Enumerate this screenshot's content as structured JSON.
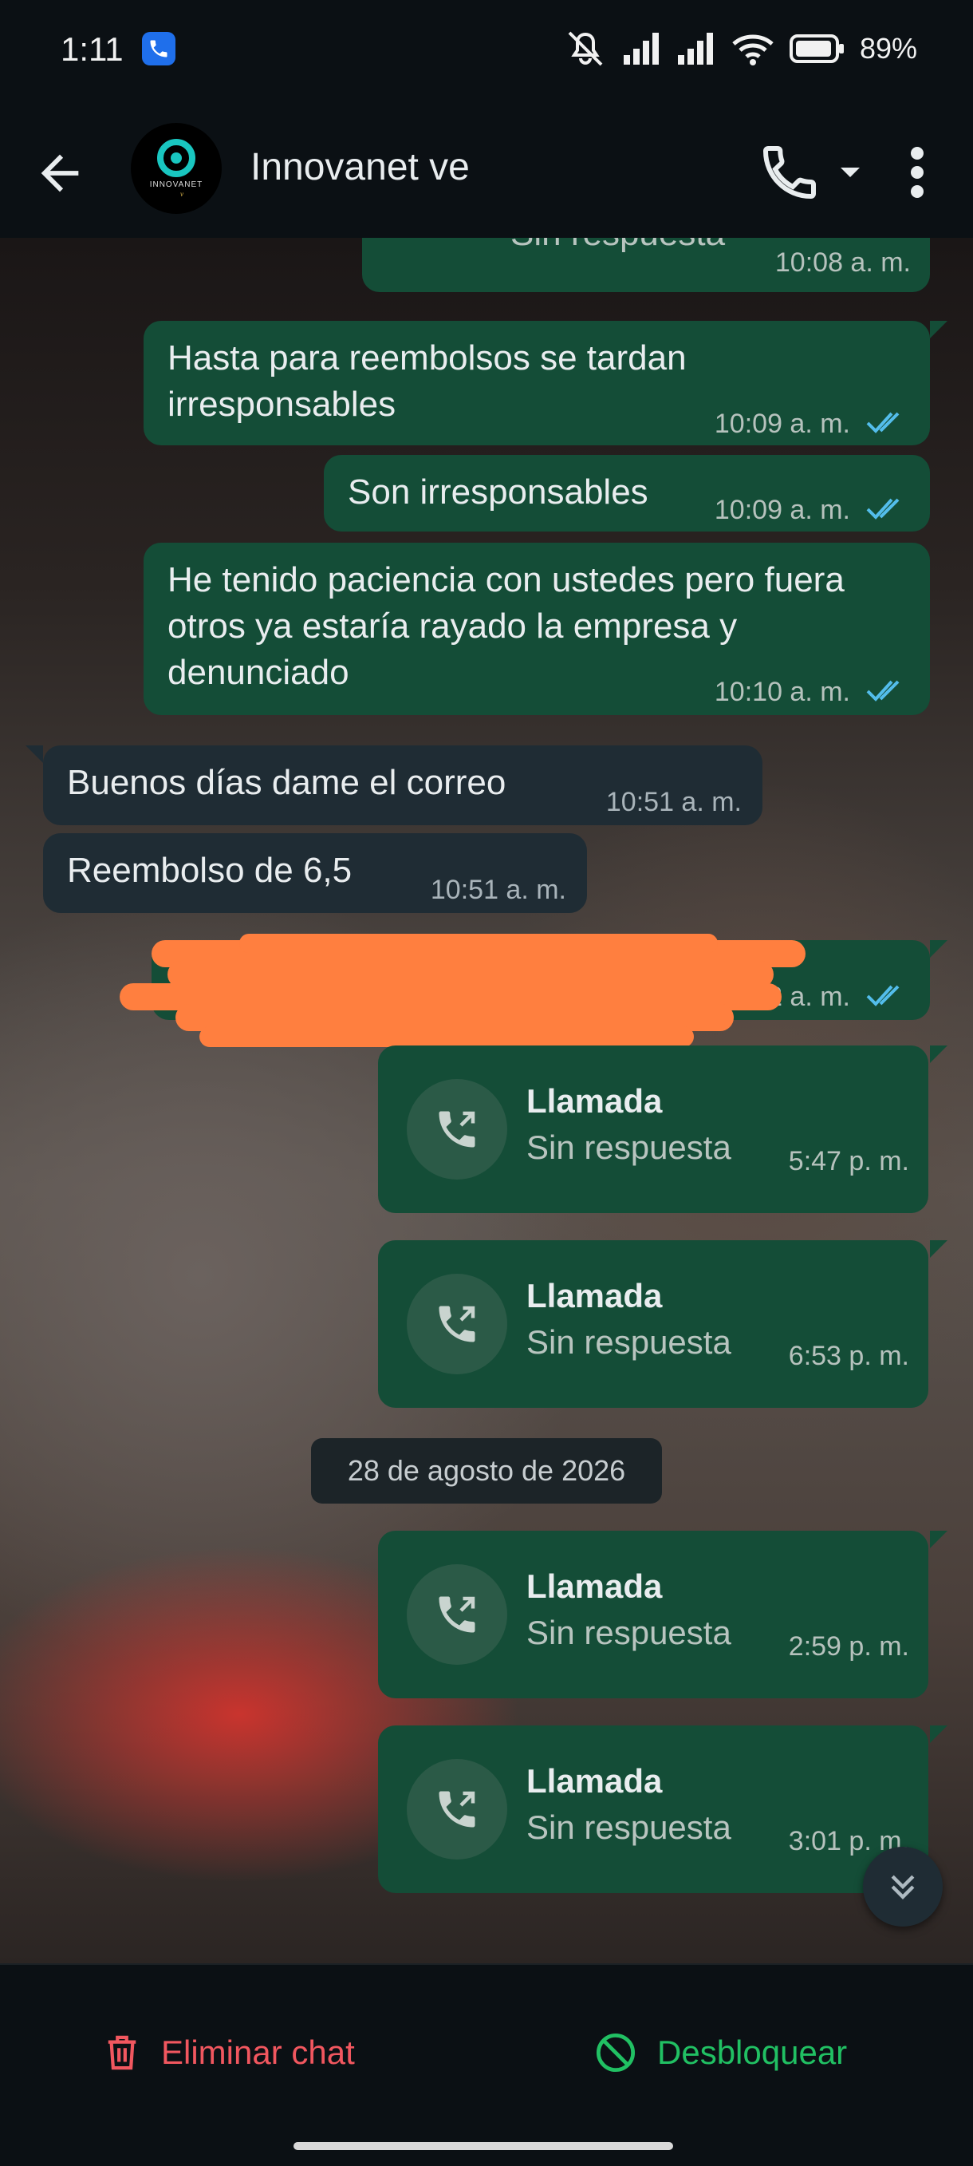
{
  "status_bar": {
    "time": "1:11",
    "battery": "89%"
  },
  "header": {
    "contact_name": "Innovanet ve",
    "avatar_text": "INNOVANET"
  },
  "messages": [
    {
      "direction": "out",
      "text": "Sin respuesta",
      "time": "10:08 a. m."
    },
    {
      "direction": "out",
      "text": "Hasta para reembolsos se tardan irresponsables",
      "time": "10:09 a. m."
    },
    {
      "direction": "out",
      "text": "Son irresponsables",
      "time": "10:09 a. m."
    },
    {
      "direction": "out",
      "text": "He tenido paciencia con ustedes pero fuera otros ya estaría rayado la empresa y denunciado",
      "time": "10:10 a. m."
    },
    {
      "direction": "in",
      "text": "Buenos días dame el correo",
      "time": "10:51 a. m."
    },
    {
      "direction": "in",
      "text": "Reembolso de 6,5",
      "time": "10:51 a. m."
    },
    {
      "direction": "out",
      "text": "",
      "time": "2 a. m."
    }
  ],
  "calls": [
    {
      "title": "Llamada",
      "status": "Sin respuesta",
      "time": "5:47 p. m."
    },
    {
      "title": "Llamada",
      "status": "Sin respuesta",
      "time": "6:53 p. m."
    },
    {
      "title": "Llamada",
      "status": "Sin respuesta",
      "time": "2:59 p. m."
    },
    {
      "title": "Llamada",
      "status": "Sin respuesta",
      "time": "3:01 p. m."
    }
  ],
  "date_separator": "28 de agosto de 2026",
  "actions": {
    "delete_label": "Eliminar chat",
    "unblock_label": "Desbloquear"
  },
  "colors": {
    "outgoing_bubble": "#144d37",
    "incoming_bubble": "#1f2c34",
    "delete_red": "#f1575f",
    "unblock_green": "#21c063",
    "read_tick_blue": "#53bdeb"
  }
}
